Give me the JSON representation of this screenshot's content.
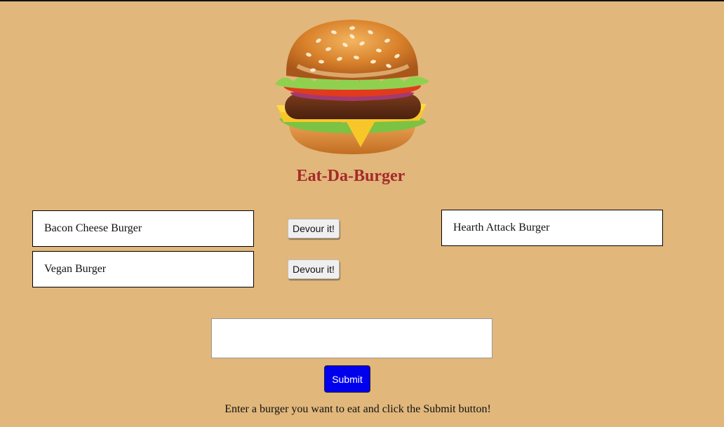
{
  "header": {
    "logo_icon": "hamburger-icon",
    "title": "Eat-Da-Burger"
  },
  "uneaten_burgers": [
    {
      "name": "Bacon Cheese Burger",
      "action_label": "Devour it!"
    },
    {
      "name": "Vegan Burger",
      "action_label": "Devour it!"
    }
  ],
  "devoured_burgers": [
    {
      "name": "Hearth Attack Burger"
    }
  ],
  "form": {
    "input_value": "",
    "input_placeholder": "",
    "submit_label": "Submit",
    "instructions": "Enter a burger you want to eat and click the Submit button!"
  },
  "colors": {
    "background": "#e1b77b",
    "title": "#a52a2a",
    "submit_button": "#0000ee"
  }
}
